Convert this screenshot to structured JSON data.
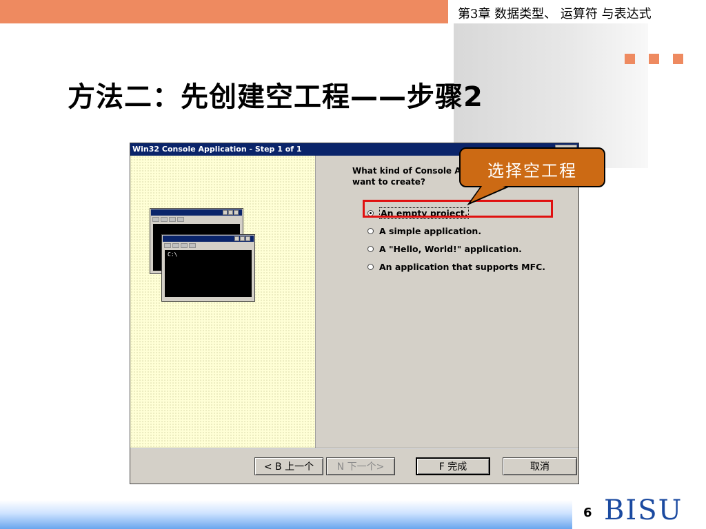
{
  "slide": {
    "chapter_title": "第3章 数据类型、 运算符 与表达式",
    "title": "方法二：先创建空工程——步骤2",
    "page_number": "6",
    "logo_text": "BISU",
    "accent_color": "#ee8a60"
  },
  "dialog": {
    "title": "Win32 Console Application - Step 1 of 1",
    "question": "What kind of Console Application do you want to create?",
    "question_visible_line1": "What kind of Console A",
    "question_visible_line2": "want to create?",
    "options": [
      {
        "label": "An empty project.",
        "selected": true
      },
      {
        "label": "A simple application.",
        "selected": false
      },
      {
        "label": "A \"Hello, World!\" application.",
        "selected": false
      },
      {
        "label": "An application that supports MFC.",
        "selected": false
      }
    ],
    "buttons": {
      "back": "< B 上一个",
      "next": "N 下一个>",
      "finish": "F 完成",
      "cancel": "取消"
    },
    "console_prompt": "C:\\"
  },
  "callout": {
    "text": "选择空工程"
  }
}
